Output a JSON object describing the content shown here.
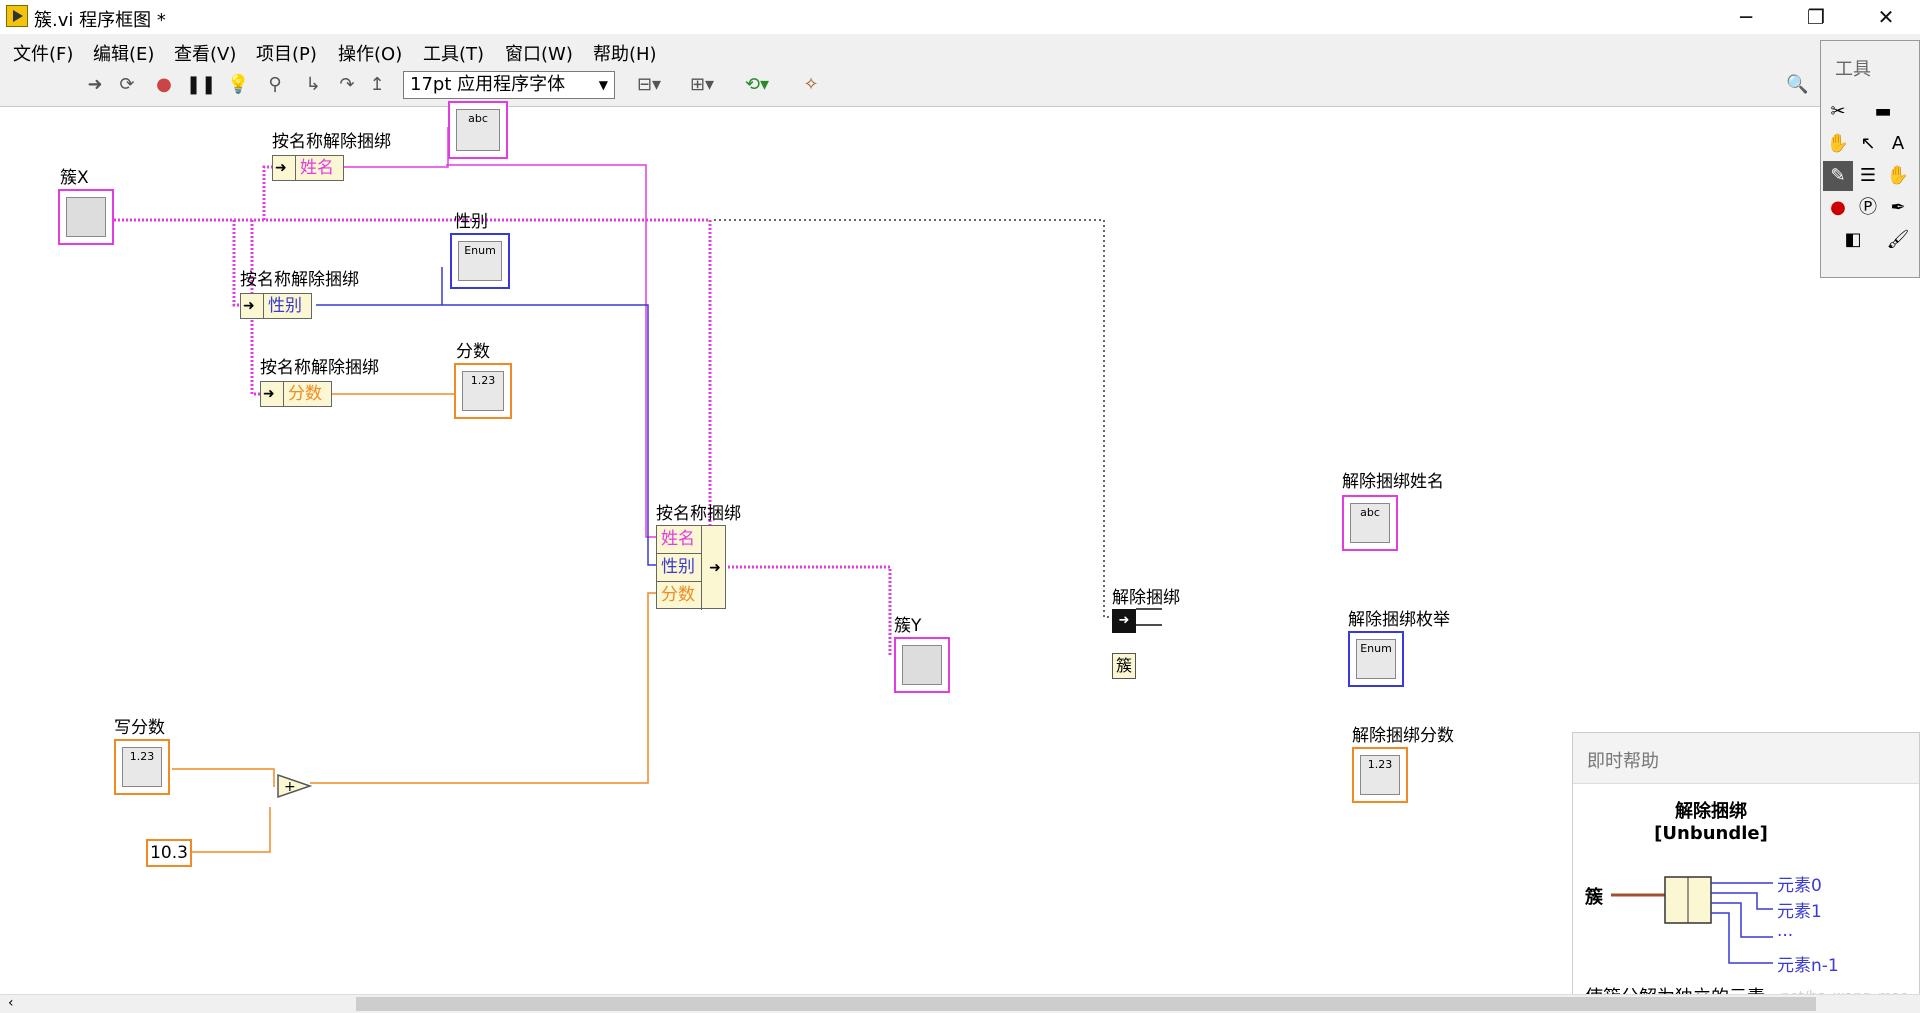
{
  "window": {
    "title": "簇.vi 程序框图 *",
    "minimize": "─",
    "restore": "❐",
    "close": "✕"
  },
  "menu": [
    "文件(F)",
    "编辑(E)",
    "查看(V)",
    "项目(P)",
    "操作(O)",
    "工具(T)",
    "窗口(W)",
    "帮助(H)"
  ],
  "toolbar": {
    "font": "17pt 应用程序字体",
    "icons": [
      "run-arrow-icon",
      "run-continuously-icon",
      "abort-icon",
      "pause-icon",
      "highlight-execution-icon",
      "retain-wire-values-icon",
      "step-into-icon",
      "step-over-icon",
      "step-out-icon",
      "align-icon",
      "distribute-icon",
      "reorder-icon",
      "cleanup-icon",
      "search-icon"
    ]
  },
  "diagram": {
    "cluster_x": "簇X",
    "cluster_y": "簇Y",
    "unbundle_name_1": "按名称解除捆绑",
    "unbundle_name_2": "按名称解除捆绑",
    "unbundle_name_3": "按名称解除捆绑",
    "field_name": "姓名",
    "field_gender": "性别",
    "field_score": "分数",
    "ind_gender": "性别",
    "ind_score": "分数",
    "bundle_by_name": "按名称捆绑",
    "bundle_fields": [
      "姓名",
      "性别",
      "分数"
    ],
    "write_score": "写分数",
    "const_value": "10.3",
    "unbundle": "解除捆绑",
    "cluster_const": "簇",
    "unbundle_name_ind": "解除捆绑姓名",
    "unbundle_enum_ind": "解除捆绑枚举",
    "unbundle_score_ind": "解除捆绑分数",
    "abc": "abc",
    "enum": "Enum",
    "dbl": "1.23"
  },
  "tools_palette": {
    "title": "工具"
  },
  "context_help": {
    "title": "即时帮助",
    "fn_name": "解除捆绑",
    "fn_name_en": "[Unbundle]",
    "input": "簇",
    "outputs": [
      "元素0",
      "元素1",
      "...",
      "元素n-1"
    ],
    "description": "使簇分解为独立的元素。",
    "watermark": "net/ba_wang_mao"
  }
}
